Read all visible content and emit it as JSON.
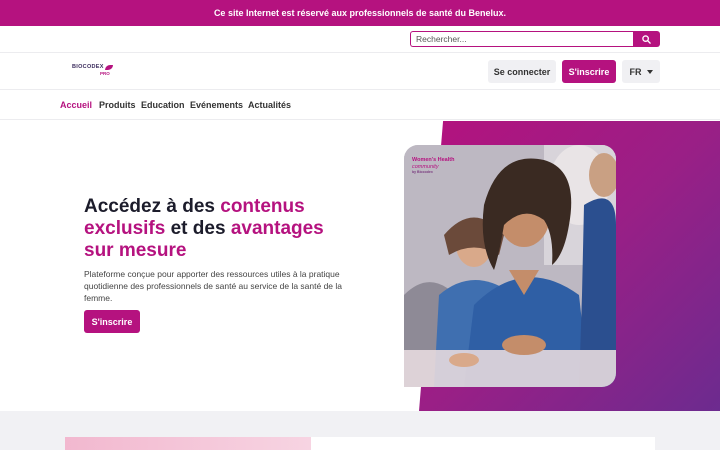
{
  "banner": {
    "text": "Ce site Internet est réservé aux professionnels de santé du Benelux."
  },
  "search": {
    "placeholder": "Rechercher..."
  },
  "header": {
    "logo_text": "BIOCODEX",
    "logo_sub": "PRO",
    "login_label": "Se connecter",
    "signup_label": "S'inscrire",
    "language": "FR"
  },
  "nav": {
    "items": [
      {
        "label": "Accueil",
        "active": true
      },
      {
        "label": "Produits",
        "active": false
      },
      {
        "label": "Education",
        "active": false
      },
      {
        "label": "Evénements",
        "active": false
      },
      {
        "label": "Actualités",
        "active": false
      }
    ]
  },
  "hero": {
    "title_part1": "Accédez à des ",
    "title_hl1": "contenus exclusifs",
    "title_part2": " et des ",
    "title_hl2": "avantages sur mesure",
    "description": "Plateforme conçue pour apporter des ressources utiles à la pratique quotidienne des professionnels de santé au service de la santé de la femme.",
    "cta_label": "S'inscrire",
    "badge_title": "Women's Health",
    "badge_sub": "community",
    "badge_by": "by Biocodex"
  },
  "colors": {
    "brand": "#b5127f",
    "purple": "#6c2b8f"
  },
  "icons": {
    "search": "search-icon",
    "language_dropdown": "chevron-down-icon"
  }
}
